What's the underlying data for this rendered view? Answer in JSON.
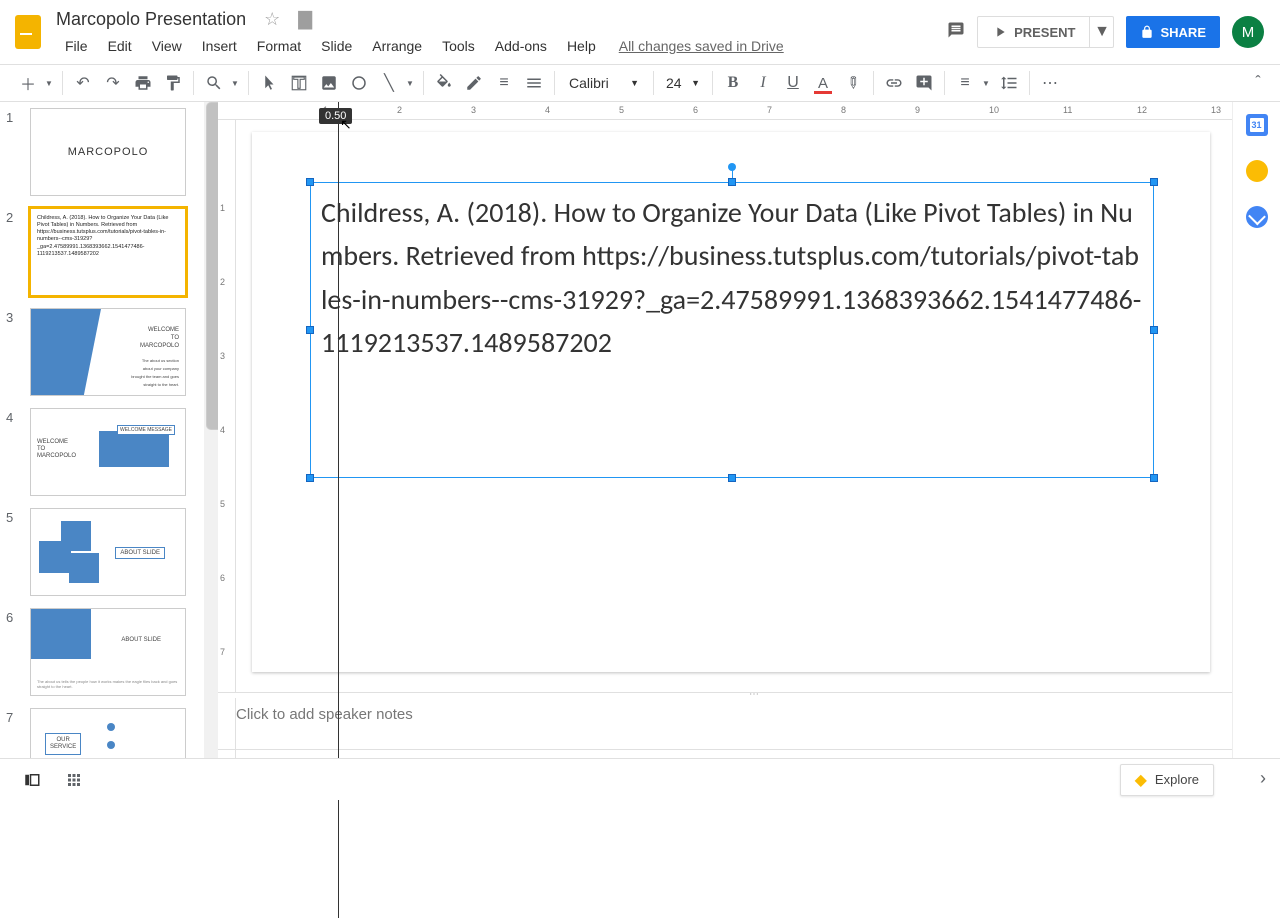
{
  "doc": {
    "title": "Marcopolo Presentation",
    "saved": "All changes saved in Drive"
  },
  "menubar": [
    "File",
    "Edit",
    "View",
    "Insert",
    "Format",
    "Slide",
    "Arrange",
    "Tools",
    "Add-ons",
    "Help"
  ],
  "header": {
    "present": "PRESENT",
    "share": "SHARE",
    "avatar": "M"
  },
  "toolbar": {
    "font": "Calibri",
    "size": "24",
    "ruler_tip": "0.50"
  },
  "slides": [
    {
      "num": "1",
      "title": "MARCOPOLO"
    },
    {
      "num": "2",
      "text": "Childress, A. (2018). How to Organize Your Data (Like Pivot Tables) in Numbers. Retrieved from https://business.tutsplus.com/tutorials/pivot-tables-in-numbers--cms-31929?_ga=2.47589991.1368393662.1541477486-1119213537.1489587202"
    },
    {
      "num": "3",
      "title": "WELCOME TO MARCOPOLO"
    },
    {
      "num": "4",
      "title": "WELCOME TO MARCOPOLO",
      "badge": "WELCOME MESSAGE"
    },
    {
      "num": "5",
      "title": "ABOUT SLIDE"
    },
    {
      "num": "6",
      "title": "ABOUT SLIDE"
    },
    {
      "num": "7",
      "title": "OUR SERVICE"
    }
  ],
  "canvas": {
    "textbox_content": "Childress, A. (2018). How to Organize Your Data (Like Pivot Tables) in Numbers. Retrieved from https://business.tutsplus.com/tutorials/pivot-tables-in-numbers--cms-31929?_ga=2.47589991.1368393662.1541477486-1119213537.1489587202"
  },
  "notes": {
    "placeholder": "Click to add speaker notes"
  },
  "bottom": {
    "explore": "Explore"
  },
  "chart_data": null
}
